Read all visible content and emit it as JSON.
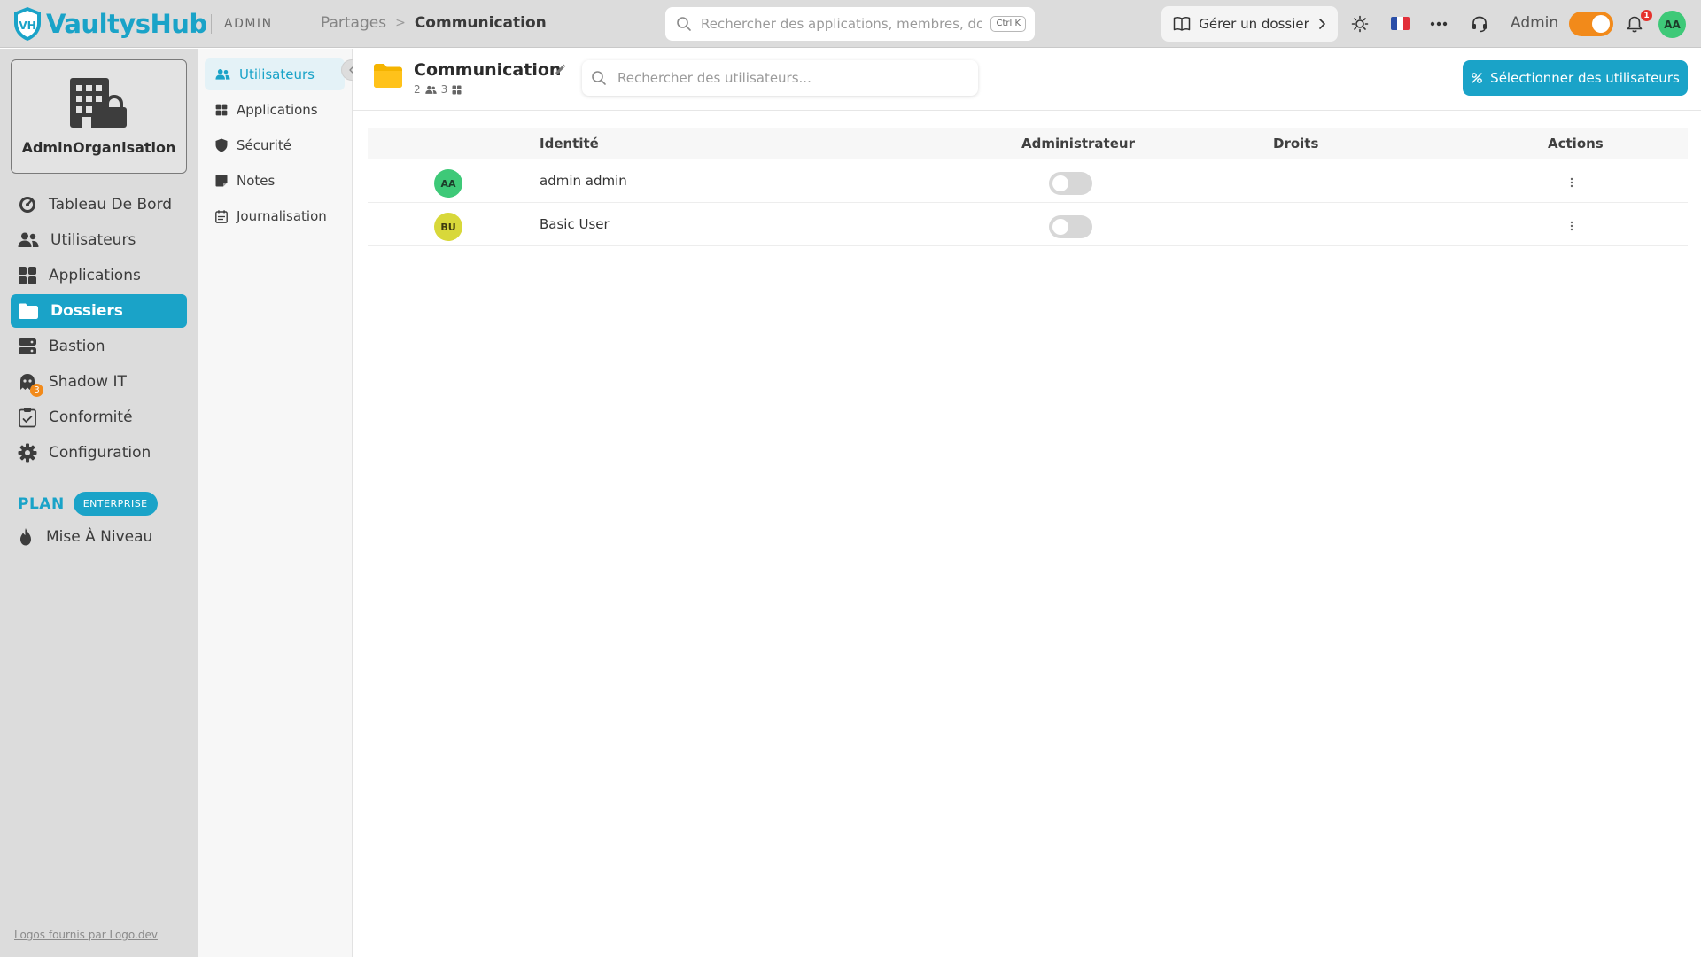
{
  "app": {
    "brand": "VaultysHub",
    "section_tag": "ADMIN",
    "brand_color": "#1aa3c8",
    "accent_color": "#f28a1a"
  },
  "breadcrumb": {
    "parent": "Partages",
    "separator": ">",
    "current": "Communication"
  },
  "global_search": {
    "placeholder": "Rechercher des applications, membres, dossiers...",
    "shortcut": "Ctrl K"
  },
  "header": {
    "manage_folder_label": "Gérer un dossier",
    "language_flag": "fr-flag",
    "admin_label": "Admin",
    "admin_mode_on": true,
    "notifications_count": "1",
    "user_initials": "AA"
  },
  "sidebar": {
    "org_name": "AdminOrganisation",
    "items": [
      {
        "label": "Tableau De Bord",
        "icon": "dashboard-gauge-icon",
        "active": false
      },
      {
        "label": "Utilisateurs",
        "icon": "users-icon",
        "active": false
      },
      {
        "label": "Applications",
        "icon": "apps-grid-icon",
        "active": false
      },
      {
        "label": "Dossiers",
        "icon": "folder-icon",
        "active": true
      },
      {
        "label": "Bastion",
        "icon": "server-icon",
        "active": false
      },
      {
        "label": "Shadow IT",
        "icon": "ghost-icon",
        "active": false,
        "badge": "3"
      },
      {
        "label": "Conformité",
        "icon": "clipboard-check-icon",
        "active": false
      },
      {
        "label": "Configuration",
        "icon": "gear-icon",
        "active": false
      }
    ],
    "plan_label": "PLAN",
    "plan_name": "ENTERPRISE",
    "upgrade_label": "Mise À Niveau",
    "footer_link": "Logos fournis par Logo.dev"
  },
  "subnav": {
    "items": [
      {
        "label": "Utilisateurs",
        "icon": "users-icon",
        "active": true
      },
      {
        "label": "Applications",
        "icon": "apps-grid-icon",
        "active": false
      },
      {
        "label": "Sécurité",
        "icon": "shield-icon",
        "active": false
      },
      {
        "label": "Notes",
        "icon": "note-icon",
        "active": false
      },
      {
        "label": "Journalisation",
        "icon": "calendar-log-icon",
        "active": false
      }
    ]
  },
  "folder": {
    "title": "Communication",
    "users_count": "2",
    "apps_count": "3"
  },
  "user_search": {
    "placeholder": "Rechercher des utilisateurs..."
  },
  "select_users_label": "Sélectionner des utilisateurs",
  "table": {
    "columns": [
      "Identité",
      "Administrateur",
      "Droits",
      "Actions"
    ],
    "rows": [
      {
        "initials": "AA",
        "name": "admin admin",
        "admin": false,
        "avatar_color": "#3ec978",
        "avatar_text_color": "#1c3d2a"
      },
      {
        "initials": "BU",
        "name": "Basic User",
        "admin": false,
        "avatar_color": "#d8d83a",
        "avatar_text_color": "#3d3a10"
      }
    ]
  }
}
